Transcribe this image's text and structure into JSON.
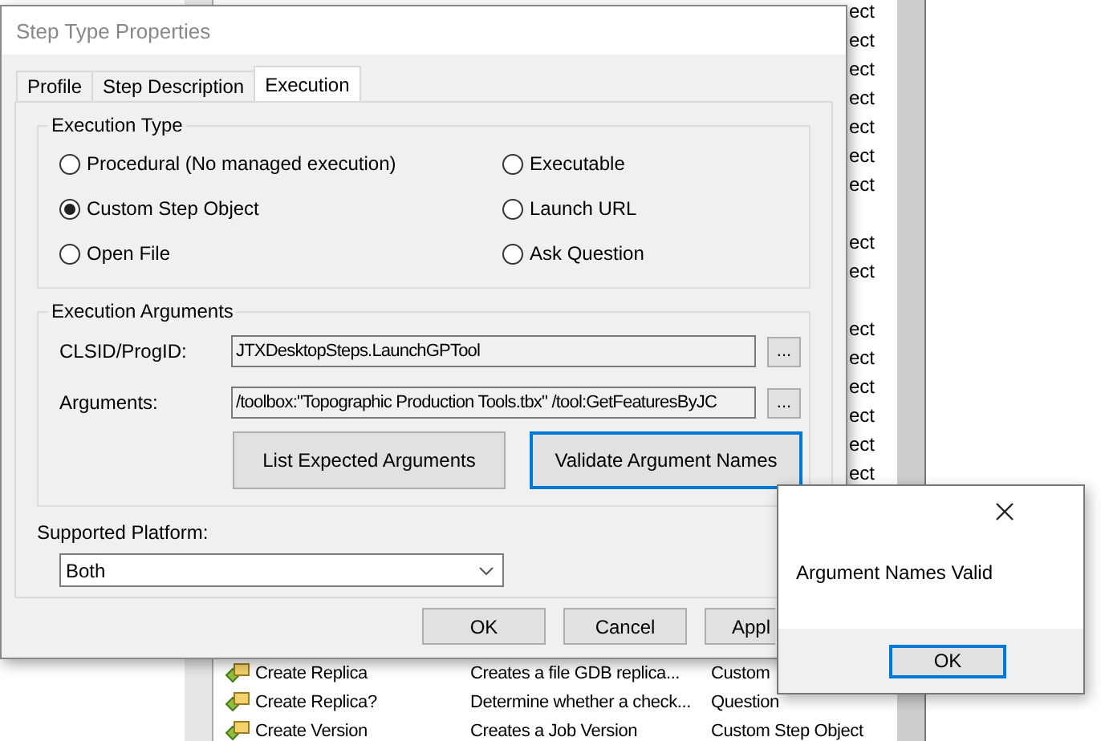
{
  "background_list": {
    "type_column_fragments": [
      [
        "ect",
        "ect",
        "ect",
        "ect",
        "ect",
        "ect",
        "ect"
      ],
      [
        "ect",
        "ect"
      ],
      [
        "ect",
        "ect",
        "ect",
        "ect",
        "ect",
        "ect"
      ]
    ],
    "rows": [
      {
        "name": "Create Replica",
        "description": "Creates a file GDB replica...",
        "type": "Custom"
      },
      {
        "name": "Create Replica?",
        "description": "Determine whether a check...",
        "type": "Question"
      },
      {
        "name": "Create Version",
        "description": "Creates a Job Version",
        "type": "Custom Step Object"
      }
    ]
  },
  "dialog": {
    "title": "Step Type Properties",
    "tabs": [
      {
        "label": "Profile",
        "selected": false
      },
      {
        "label": "Step Description",
        "selected": false
      },
      {
        "label": "Execution",
        "selected": true
      }
    ],
    "execution_type": {
      "label": "Execution Type",
      "options": [
        {
          "label": "Procedural (No managed execution)",
          "selected": false
        },
        {
          "label": "Executable",
          "selected": false
        },
        {
          "label": "Custom Step Object",
          "selected": true
        },
        {
          "label": "Launch URL",
          "selected": false
        },
        {
          "label": "Open File",
          "selected": false
        },
        {
          "label": "Ask Question",
          "selected": false
        }
      ]
    },
    "execution_arguments": {
      "label": "Execution Arguments",
      "fields": [
        {
          "label": "CLSID/ProgID:",
          "value": "JTXDesktopSteps.LaunchGPTool",
          "browse": "..."
        },
        {
          "label": "Arguments:",
          "value": "/toolbox:\"Topographic Production Tools.tbx\" /tool:GetFeaturesByJC",
          "browse": "..."
        }
      ],
      "buttons": [
        {
          "label": "List Expected Arguments",
          "focused": false
        },
        {
          "label": "Validate Argument Names",
          "focused": true
        }
      ]
    },
    "supported_platform": {
      "label": "Supported Platform:",
      "value": "Both"
    },
    "buttons": [
      "OK",
      "Cancel",
      "Appl"
    ]
  },
  "message_box": {
    "message": "Argument Names Valid",
    "button": "OK"
  }
}
